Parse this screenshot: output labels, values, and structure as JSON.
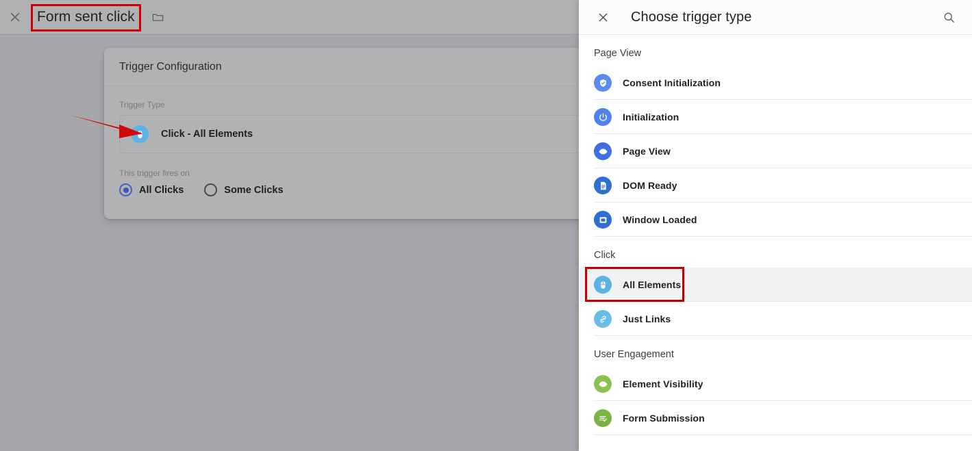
{
  "topbar": {
    "close_icon": "close-icon",
    "trigger_name": "Form sent click",
    "folder_icon": "folder-icon"
  },
  "annotations": {
    "title_highlight_color": "#d00000",
    "arrow_color": "#cf0a0a",
    "list_highlight_color": "#c00000"
  },
  "config_card": {
    "title": "Trigger Configuration",
    "trigger_type_label": "Trigger Type",
    "trigger_type_value": "Click - All Elements",
    "trigger_type_icon": "mouse-click-icon",
    "fires_on_label": "This trigger fires on",
    "radio_options": [
      {
        "label": "All Clicks",
        "checked": true
      },
      {
        "label": "Some Clicks",
        "checked": false
      }
    ]
  },
  "side_panel": {
    "close_icon": "close-icon",
    "title": "Choose trigger type",
    "search_icon": "search-icon",
    "groups": [
      {
        "name": "Page View",
        "items": [
          {
            "label": "Consent Initialization",
            "icon": "shield-check-icon",
            "color": "#5b8bef",
            "highlighted": false
          },
          {
            "label": "Initialization",
            "icon": "power-icon",
            "color": "#4f82ee",
            "highlighted": false
          },
          {
            "label": "Page View",
            "icon": "eye-icon",
            "color": "#3f6fe0",
            "highlighted": false
          },
          {
            "label": "DOM Ready",
            "icon": "document-icon",
            "color": "#2f6fd0",
            "highlighted": false
          },
          {
            "label": "Window Loaded",
            "icon": "window-icon",
            "color": "#2f6fd0",
            "highlighted": false
          }
        ]
      },
      {
        "name": "Click",
        "items": [
          {
            "label": "All Elements",
            "icon": "mouse-click-icon",
            "color": "#5cb3e4",
            "highlighted": true
          },
          {
            "label": "Just Links",
            "icon": "link-icon",
            "color": "#68bce8",
            "highlighted": false
          }
        ]
      },
      {
        "name": "User Engagement",
        "items": [
          {
            "label": "Element Visibility",
            "icon": "eye-icon",
            "color": "#8cc152",
            "highlighted": false
          },
          {
            "label": "Form Submission",
            "icon": "form-check-icon",
            "color": "#7cb342",
            "highlighted": false
          }
        ]
      }
    ]
  }
}
